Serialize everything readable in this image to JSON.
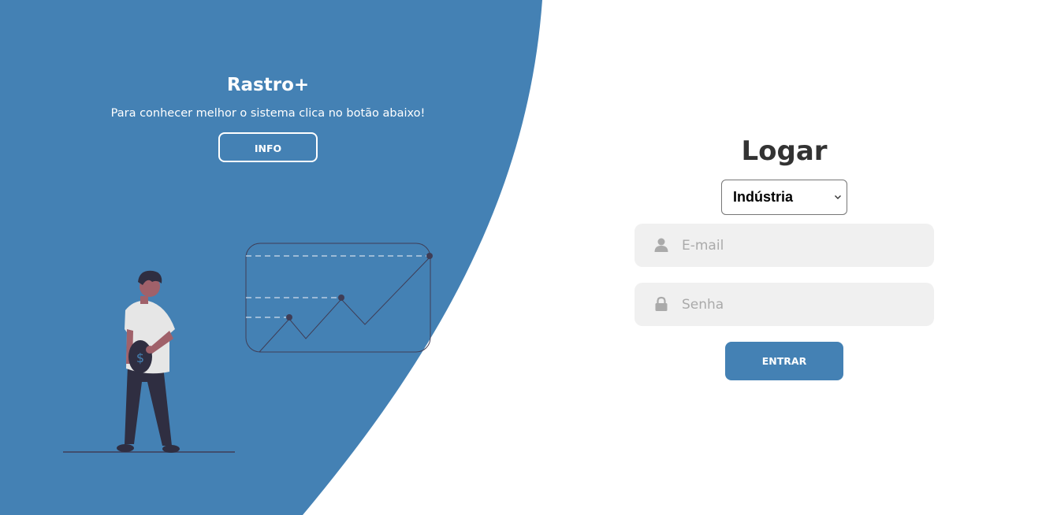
{
  "colors": {
    "primary": "#4481b4",
    "input_bg": "#f0f0f0",
    "title": "#333333",
    "illustration_dark": "#2f2e41",
    "illustration_skin": "#a0616a"
  },
  "left_panel": {
    "title": "Rastro+",
    "text": "Para conhecer melhor o sistema clica no botão abaixo!",
    "info_button": "INFO"
  },
  "login": {
    "title": "Logar",
    "type_select": {
      "value": "Indústria"
    },
    "email": {
      "placeholder": "E-mail",
      "icon": "user-icon"
    },
    "password": {
      "placeholder": "Senha",
      "icon": "lock-icon"
    },
    "submit_label": "ENTRAR"
  }
}
